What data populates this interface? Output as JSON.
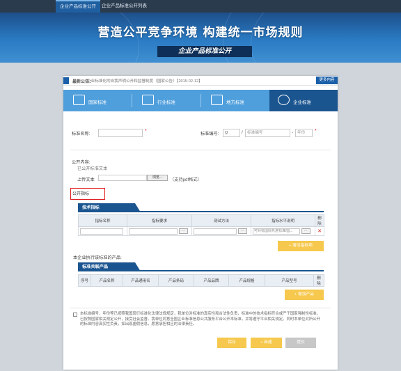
{
  "topnav": {
    "tabs": [
      "企业产品标准公开",
      "企业产品标准公开列表"
    ]
  },
  "banner": {
    "title": "营造公平竞争环境 构建统一市场规则",
    "subtitle": "企业产品标准公开"
  },
  "notice": {
    "label": "最新公告：",
    "text": "企业标准化的自我声明公开和监督制度（国家公告）【2015-02-12】",
    "more": "更多内容"
  },
  "categories": [
    "国家标准",
    "行业标准",
    "地方标准",
    "企业标准"
  ],
  "form": {
    "std_name_label": "标准名称:",
    "std_no_label": "标准编号:",
    "std_no_prefix": "Q",
    "std_no_placeholder": "标准编号",
    "year_placeholder": "年份",
    "required_mark": "*",
    "public_content_label": "公开内容:",
    "std_text_label": "已公开标准文本",
    "upload_label": "上传文本",
    "browse_label": "浏览...",
    "format_hint": "（支持pdf格式）",
    "disclose_indicator_label": "公开指标"
  },
  "tech": {
    "title": "技术指标",
    "columns": [
      "指标名称",
      "指标要求",
      "测试方法",
      "指标水平说明",
      "删除"
    ],
    "row": {
      "level_placeholder": "可对标国际先进标准/国..."
    },
    "add_label": "+ 增加指标项"
  },
  "products": {
    "intro": "本企业执行该标准的产品:",
    "title": "标准关联产品",
    "columns": [
      "序号",
      "产品名称",
      "产品通用名",
      "产品条码",
      "产品品牌",
      "产品规格",
      "产品型号",
      "删除"
    ],
    "add_label": "+ 增加产品"
  },
  "disclaimer": "本标准编号、年份等已按照我国现行标准化法律法规规定，我单位对标准的真实性和合法性负责，标准中的技术指标符合或严于国家强制性标准，已按照国家相关规定公开，接受社会监督。我单位同意全国企业标准信息公共服务平台公开本标准，并将遵守平台相关规定。同时本单位对所公开的标准内容真实性负责，如出现虚假信息，愿意承担相应的法律责任。",
  "actions": {
    "save": "保存",
    "save_publish": "+ 新建",
    "submit": "提交"
  },
  "colors": {
    "brand": "#1b5590",
    "accent": "#f6c84d",
    "required": "#e02020"
  }
}
